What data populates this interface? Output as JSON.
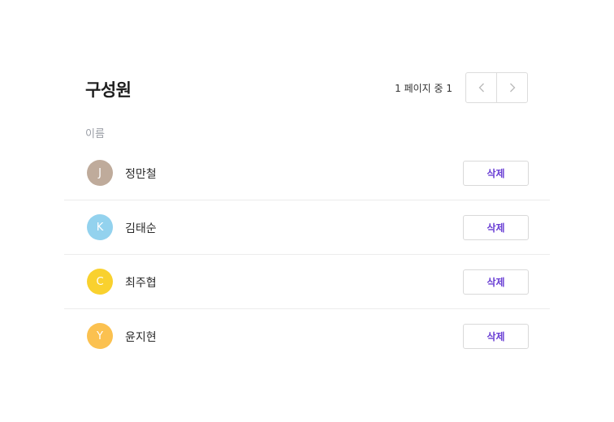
{
  "header": {
    "title": "구성원",
    "page_info": "1 페이지 중 1"
  },
  "table": {
    "column_name": "이름"
  },
  "members": [
    {
      "initial": "J",
      "name": "정만철",
      "avatar_color": "#bfab9b",
      "delete_label": "삭제"
    },
    {
      "initial": "K",
      "name": "김태순",
      "avatar_color": "#93d2ee",
      "delete_label": "삭제"
    },
    {
      "initial": "C",
      "name": "최주협",
      "avatar_color": "#f9d12e",
      "delete_label": "삭제"
    },
    {
      "initial": "Y",
      "name": "윤지현",
      "avatar_color": "#fbc150",
      "delete_label": "삭제"
    }
  ],
  "colors": {
    "accent": "#6a3fd4"
  },
  "icons": {
    "prev": "chevron-left-icon",
    "next": "chevron-right-icon"
  }
}
